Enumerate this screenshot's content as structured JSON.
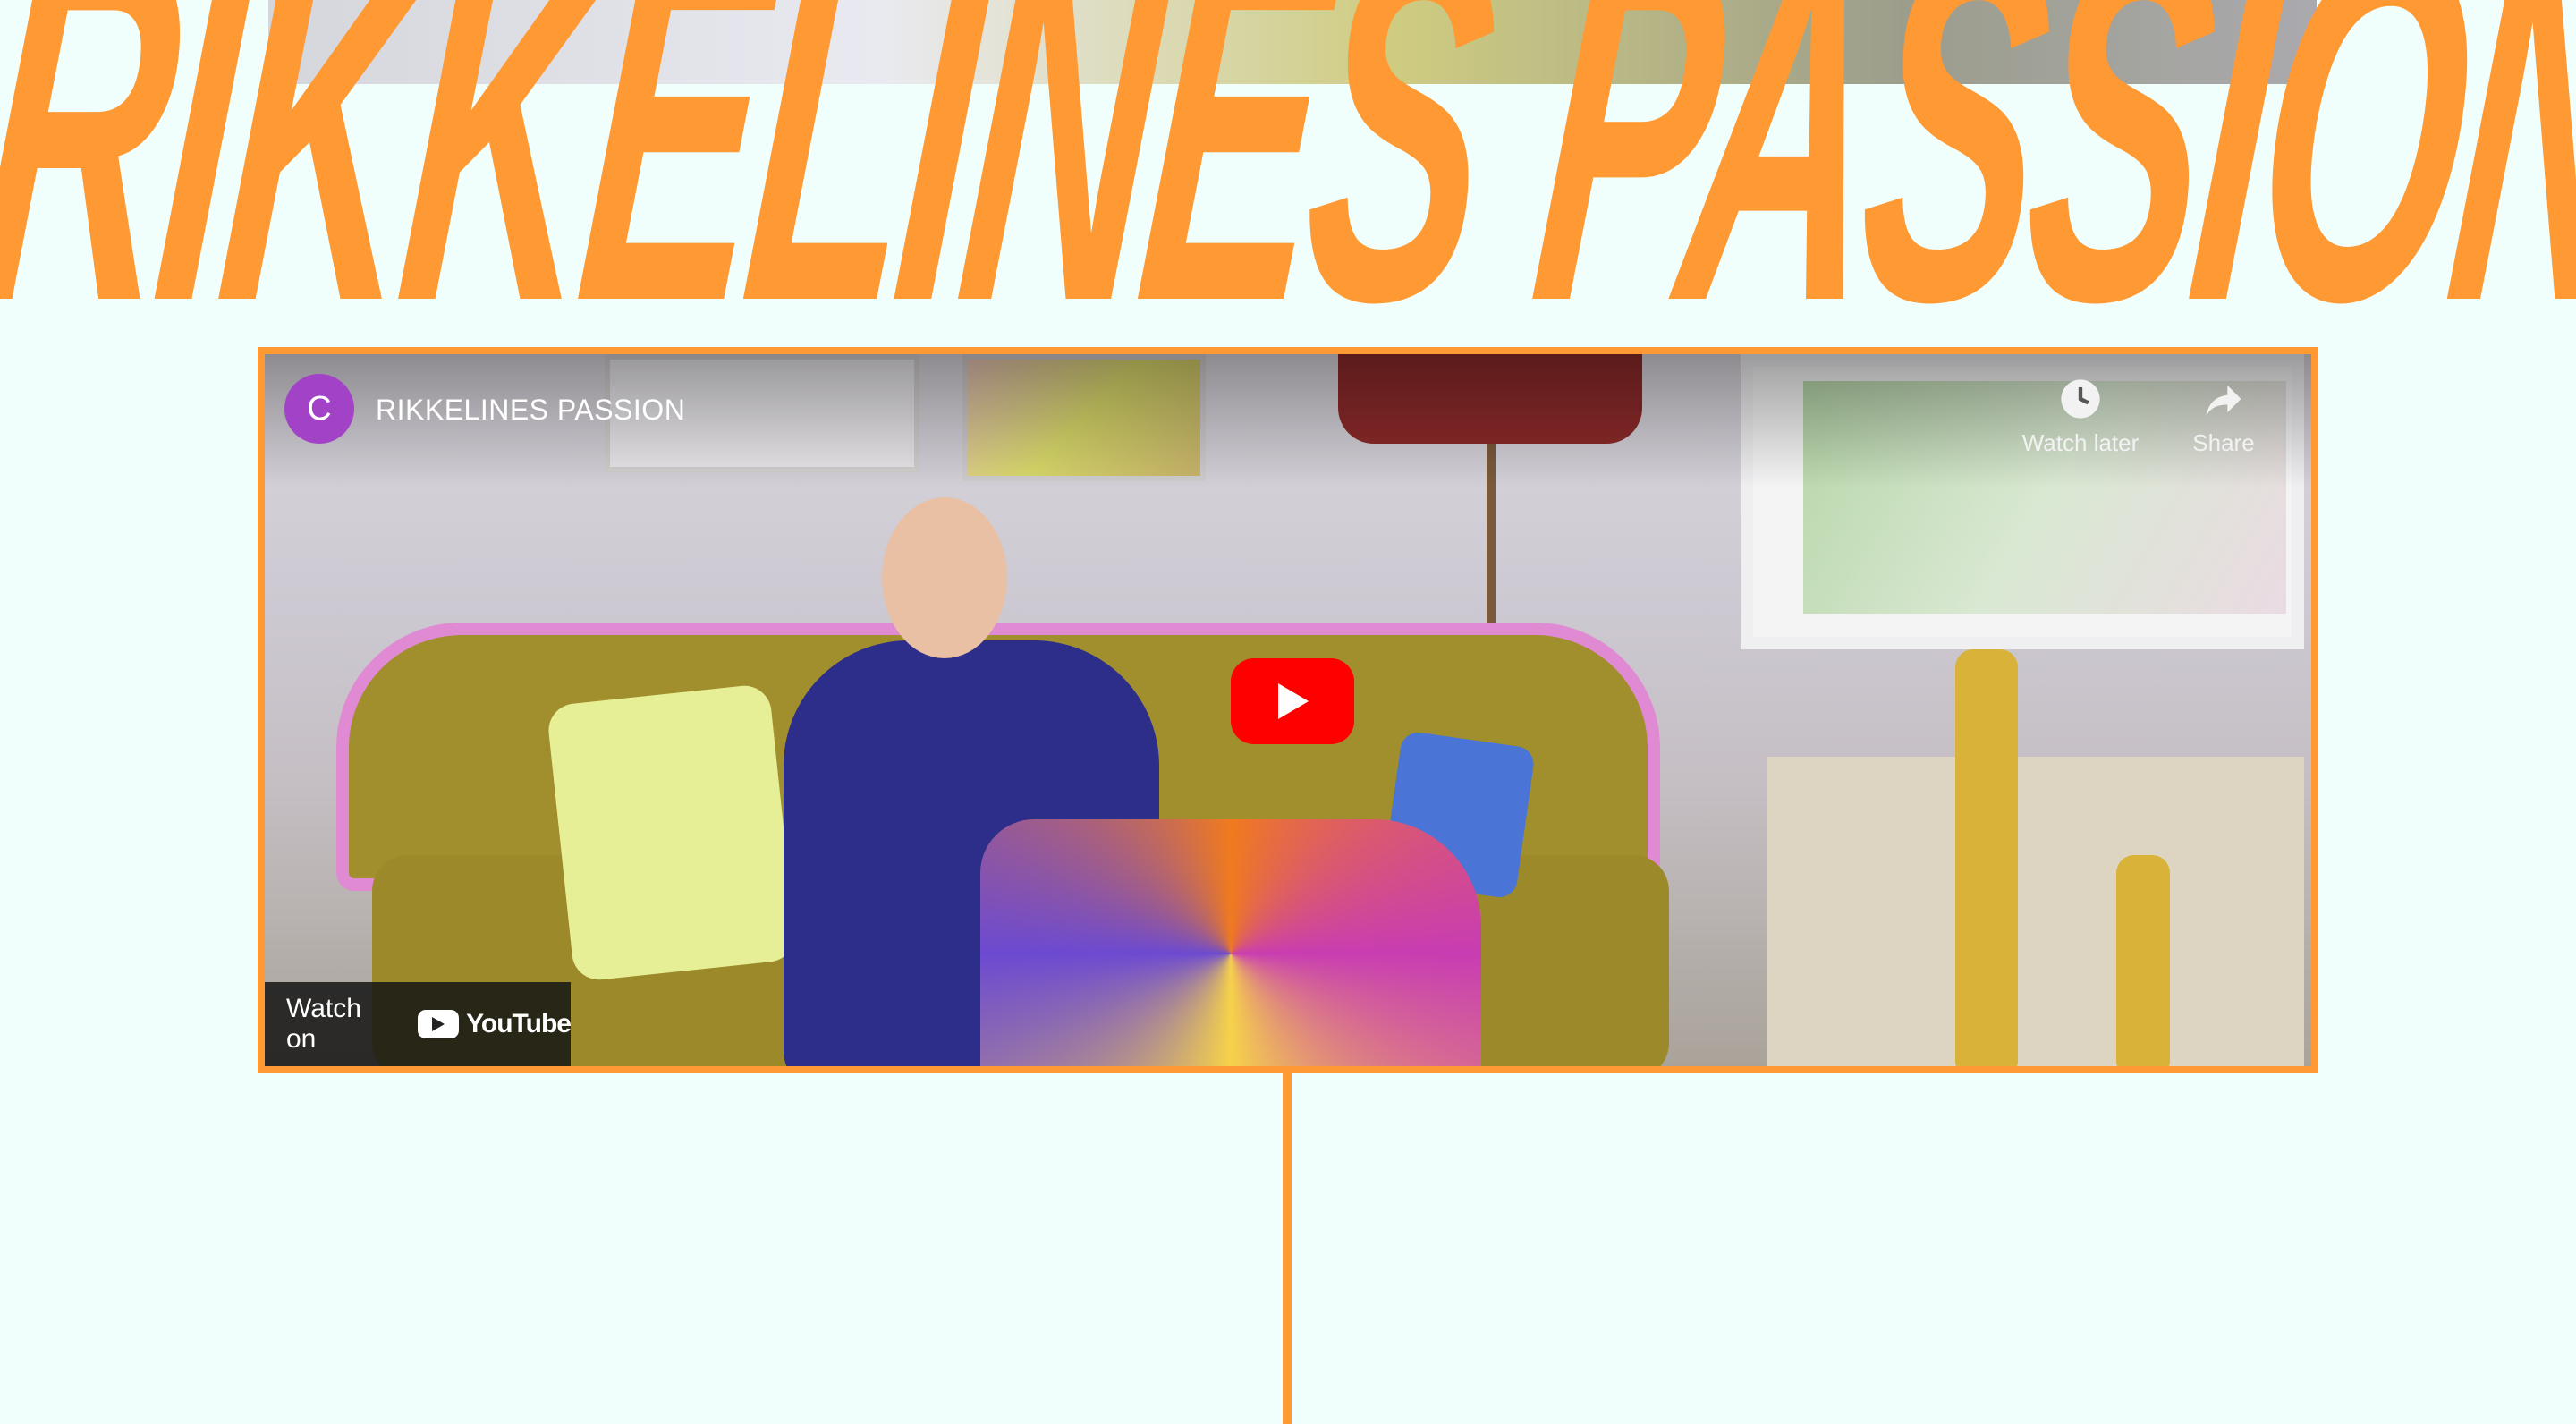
{
  "headline": {
    "text": "RIKKELINES PASSION",
    "color": "#ff9933"
  },
  "video": {
    "channel_initial": "C",
    "title": "RIKKELINES PASSION",
    "actions": [
      {
        "label": "Watch later",
        "icon": "clock-icon"
      },
      {
        "label": "Share",
        "icon": "share-icon"
      }
    ],
    "watch_on_label": "Watch on",
    "youtube_logo_text": "YouTube",
    "accent": "#ff0000",
    "frame_color": "#ff9933"
  },
  "colors": {
    "background": "#f0fffb",
    "accent": "#ff9933"
  }
}
